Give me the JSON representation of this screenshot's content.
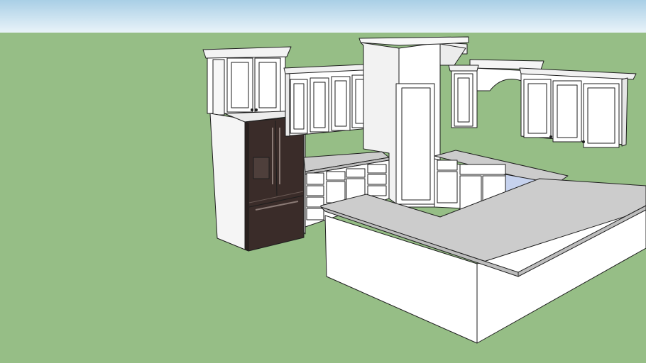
{
  "viewport": {
    "sky_color_top": "#a9cfe6",
    "sky_color_bottom": "#e9f3f9",
    "ground_color": "#96be86",
    "edge_color": "#1e1e1e",
    "cabinet_face": "#ffffff",
    "cabinet_shade": "#e6e6e6",
    "countertop_color": "#cccccc",
    "countertop_edge": "#bdbdbd",
    "fridge_color": "#3a2c29",
    "fridge_shade": "#2a201e",
    "window_glass": "#c6d2ee"
  },
  "scene": {
    "objects": [
      "tall-pantry-cabinet",
      "refrigerator",
      "upper-wall-cabinets-left",
      "corner-pantry-column",
      "upper-wall-cabinets-right",
      "arched-valance",
      "base-cabinets-left",
      "base-cabinets-right",
      "peninsula-island"
    ]
  }
}
